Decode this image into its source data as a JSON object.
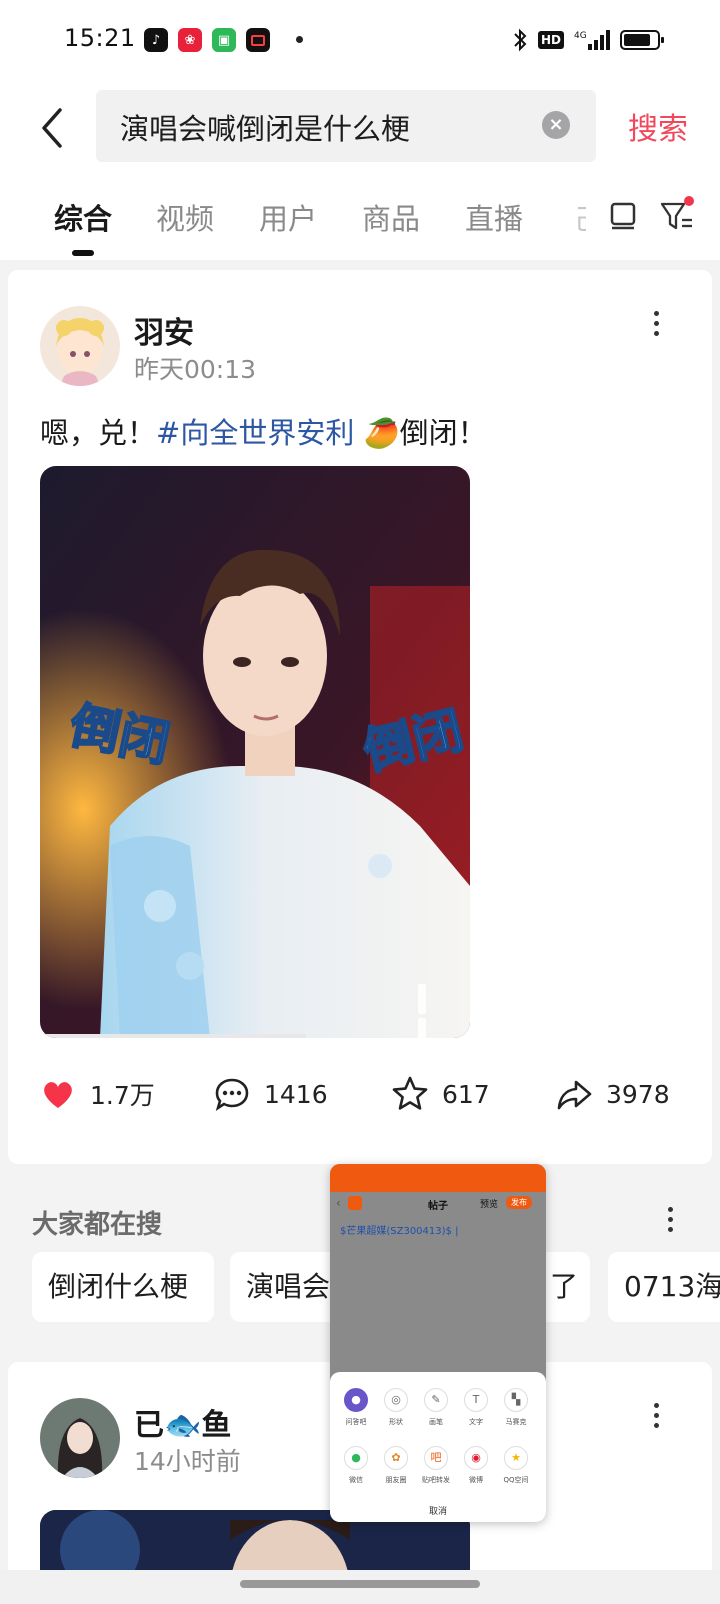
{
  "status_bar": {
    "time": "15:21",
    "right_indicators": [
      "bluetooth-icon",
      "HD",
      "4G",
      "signal-icon",
      "battery-icon"
    ],
    "apps": [
      "tiktok-icon",
      "app-red-icon",
      "app-green-icon",
      "app-screen-record-icon"
    ]
  },
  "search": {
    "query": "演唱会喊倒闭是什么梗",
    "button_label": "搜索",
    "clear_icon": "clear-icon",
    "back_icon": "back-arrow-icon"
  },
  "tabs": {
    "items": [
      {
        "label": "综合",
        "active": true
      },
      {
        "label": "视频",
        "active": false
      },
      {
        "label": "用户",
        "active": false
      },
      {
        "label": "商品",
        "active": false
      },
      {
        "label": "直播",
        "active": false
      }
    ],
    "cut_tab_label": "己"
  },
  "post1": {
    "author": "羽安",
    "time": "昨天00:13",
    "text_prefix": "嗯，兑！",
    "hashtag": "#向全世界安利",
    "text_suffix": "倒闭！",
    "emoji": "🥭",
    "video_caption_left": "倒闭",
    "video_caption_right": "倒闭",
    "likes": "1.7万",
    "comments": "1416",
    "favorites": "617",
    "shares": "3978"
  },
  "popular": {
    "title": "大家都在搜",
    "chips": [
      "倒闭什么梗",
      "演唱会",
      "了",
      "0713海"
    ]
  },
  "post2": {
    "author_before": "已",
    "author_emoji": "🐟",
    "author_after": "鱼",
    "time": "14小时前"
  },
  "overlay": {
    "nav_title": "帖子",
    "nav_preview": "预览",
    "nav_publish": "发布",
    "input_text": "$芒果超媒(SZ300413)$ |",
    "row1": [
      "问答吧",
      "形状",
      "画笔",
      "文字",
      "马赛克"
    ],
    "row2": [
      "微信",
      "朋友圈",
      "贴吧转发",
      "微博",
      "QQ空间"
    ],
    "cancel": "取消",
    "brand_color": "#f05a10"
  },
  "colors": {
    "accent": "#f0495b",
    "hashtag": "#2d56a3",
    "like": "#f5344a"
  }
}
